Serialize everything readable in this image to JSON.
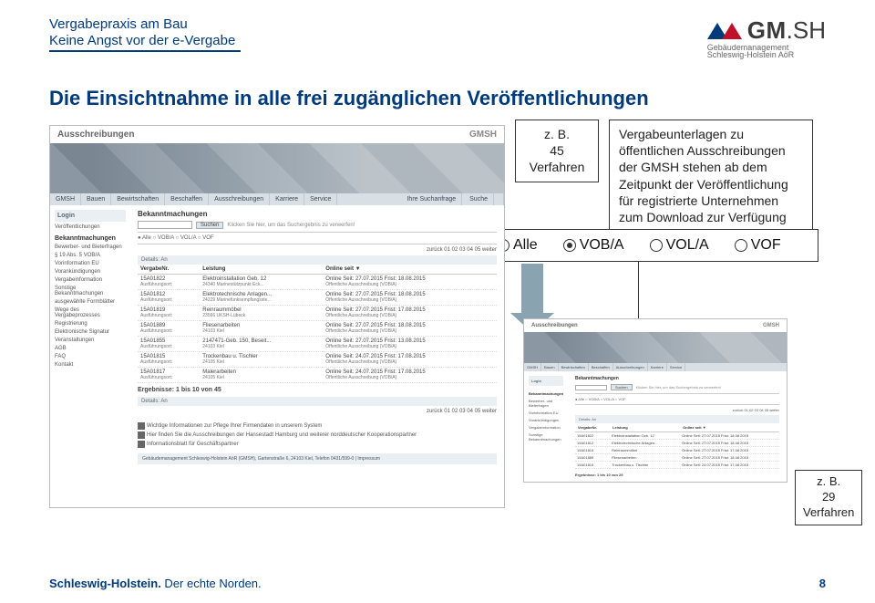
{
  "header": {
    "line1": "Vergabepraxis am Bau",
    "line2": "Keine Angst vor der e-Vergabe"
  },
  "logo": {
    "brand_a": "GM",
    "brand_b": ".SH",
    "sub1": "Gebäudemanagement",
    "sub2": "Schleswig-Holstein AöR"
  },
  "headline": "Die Einsichtnahme in alle frei zugänglichen Veröffentlichungen",
  "callout_left": {
    "l1": "z. B.",
    "l2": "45",
    "l3": "Verfahren"
  },
  "callout_right": {
    "l1": "Vergabeunterlagen zu",
    "l2": "öffentlichen Ausschreibungen",
    "l3": "der GMSH stehen ab dem",
    "l4": "Zeitpunkt der Veröffentlichung",
    "l5": "für registrierte Unternehmen",
    "l6": "zum Download zur Verfügung"
  },
  "radio": {
    "all": "Alle",
    "voba": "VOB/A",
    "vola": "VOL/A",
    "vof": "VOF"
  },
  "callout_br": {
    "l1": "z. B.",
    "l2": "29",
    "l3": "Verfahren"
  },
  "shot": {
    "page_title": "Ausschreibungen",
    "brand": "GMSH",
    "nav": [
      "GMSH",
      "Bauen",
      "Bewirtschaften",
      "Beschaffen",
      "Ausschreibungen",
      "Karriere",
      "Service"
    ],
    "nav_search_label": "Ihre Suchanfrage",
    "nav_search_btn": "Suche",
    "login": "Login",
    "bekannt_title": "Bekanntmachungen",
    "sidebar": [
      "Veröffentlichungen",
      "Bekanntmachungen",
      "Bewerber- und Bieterfragen",
      "§ 19 Abs. 5 VOB/A",
      "Vorinformation EU",
      "Vorankündigungen",
      "Vergabeinformation",
      "Sonstige Bekanntmachungen",
      "ausgewählte Formblätter",
      "Wege des Vergabeprozesses",
      "Registrierung",
      "Elektronische Signatur",
      "Veranstaltungen",
      "AGB",
      "FAQ",
      "Kontakt"
    ],
    "btn_search": "Suchen",
    "search_hint": "Klicken Sie hier, um das Suchergebnis zu verwerfen!",
    "filter": "● Alle  ○ VOB/A  ○ VOL/A  ○ VOF",
    "pager": "zurück  01 02 03 04 05  weiter",
    "details_bar": "Details: An",
    "th_nr": "VergabeNr.",
    "th_leist": "Leistung",
    "th_online": "Online seit ▼",
    "rows": [
      {
        "nr": "15A01822",
        "ort": "Ausführungsort:",
        "l": "Elektroinstallation Geb. 12",
        "l2": "24340 Marinestützpunkt Eck...",
        "o": "Online Seit: 27.07.2015  Frist: 18.08.2015",
        "o2": "Öffentliche Ausschreibung (VOB/A)"
      },
      {
        "nr": "15A01812",
        "ort": "Ausführungsort:",
        "l": "Elektrotechnische Anlagen...",
        "l2": "24229 Marinefunksempfangsste...",
        "o": "Online Seit: 27.07.2015  Frist: 18.08.2015",
        "o2": "Öffentliche Ausschreibung (VOB/A)"
      },
      {
        "nr": "15A01819",
        "ort": "Ausführungsort:",
        "l": "Reinraummöbel",
        "l2": "23566 UKSH-Lübeck",
        "o": "Online Seit: 27.07.2015  Frist: 17.08.2015",
        "o2": "Öffentliche Ausschreibung (VOB/A)"
      },
      {
        "nr": "15A01889",
        "ort": "Ausführungsort:",
        "l": "Fliesenarbeiten",
        "l2": "24103 Kiel",
        "o": "Online Seit: 27.07.2015  Frist: 18.08.2015",
        "o2": "Öffentliche Ausschreibung (VOB/A)"
      },
      {
        "nr": "15A01855",
        "ort": "Ausführungsort:",
        "l": "2147471-Geb. 150, Beseit...",
        "l2": "24103 Kiel",
        "o": "Online Seit: 27.07.2015  Frist: 13.08.2015",
        "o2": "Öffentliche Ausschreibung (VOB/A)"
      },
      {
        "nr": "15A01815",
        "ort": "Ausführungsort:",
        "l": "Trockenbau u. Tischler",
        "l2": "24105 Kiel",
        "o": "Online Seit: 24.07.2015  Frist: 17.08.2015",
        "o2": "Öffentliche Ausschreibung (VOB/A)"
      },
      {
        "nr": "15A01817",
        "ort": "Ausführungsort:",
        "l": "Malerarbeiten",
        "l2": "24105 Kiel",
        "o": "Online Seit: 24.07.2015  Frist: 17.08.2015",
        "o2": "Öffentliche Ausschreibung (VOB/A)"
      }
    ],
    "ergebnisse": "Ergebnisse: 1 bis 10 von 45",
    "ergebnisse_small": "Ergebnisse: 1 bis 10 von 29",
    "notes": {
      "n1": "Wichtige Informationen zur Pflege Ihrer Firmendaten in unserem System",
      "n2": "Hier finden Sie die Ausschreibungen der Hansestadt Hamburg und weiterer norddeutscher Kooperationspartner",
      "n3": "Informationsblatt für Geschäftspartner"
    },
    "impressum": "Gebäudemanagement Schleswig-Holstein AöR (GMSH), Gartenstraße 6, 24103 Kiel, Telefon 0431/599-0 | Impressum"
  },
  "footer": {
    "left_b": "Schleswig-Holstein.",
    "left_r": " Der echte Norden.",
    "page": "8"
  }
}
